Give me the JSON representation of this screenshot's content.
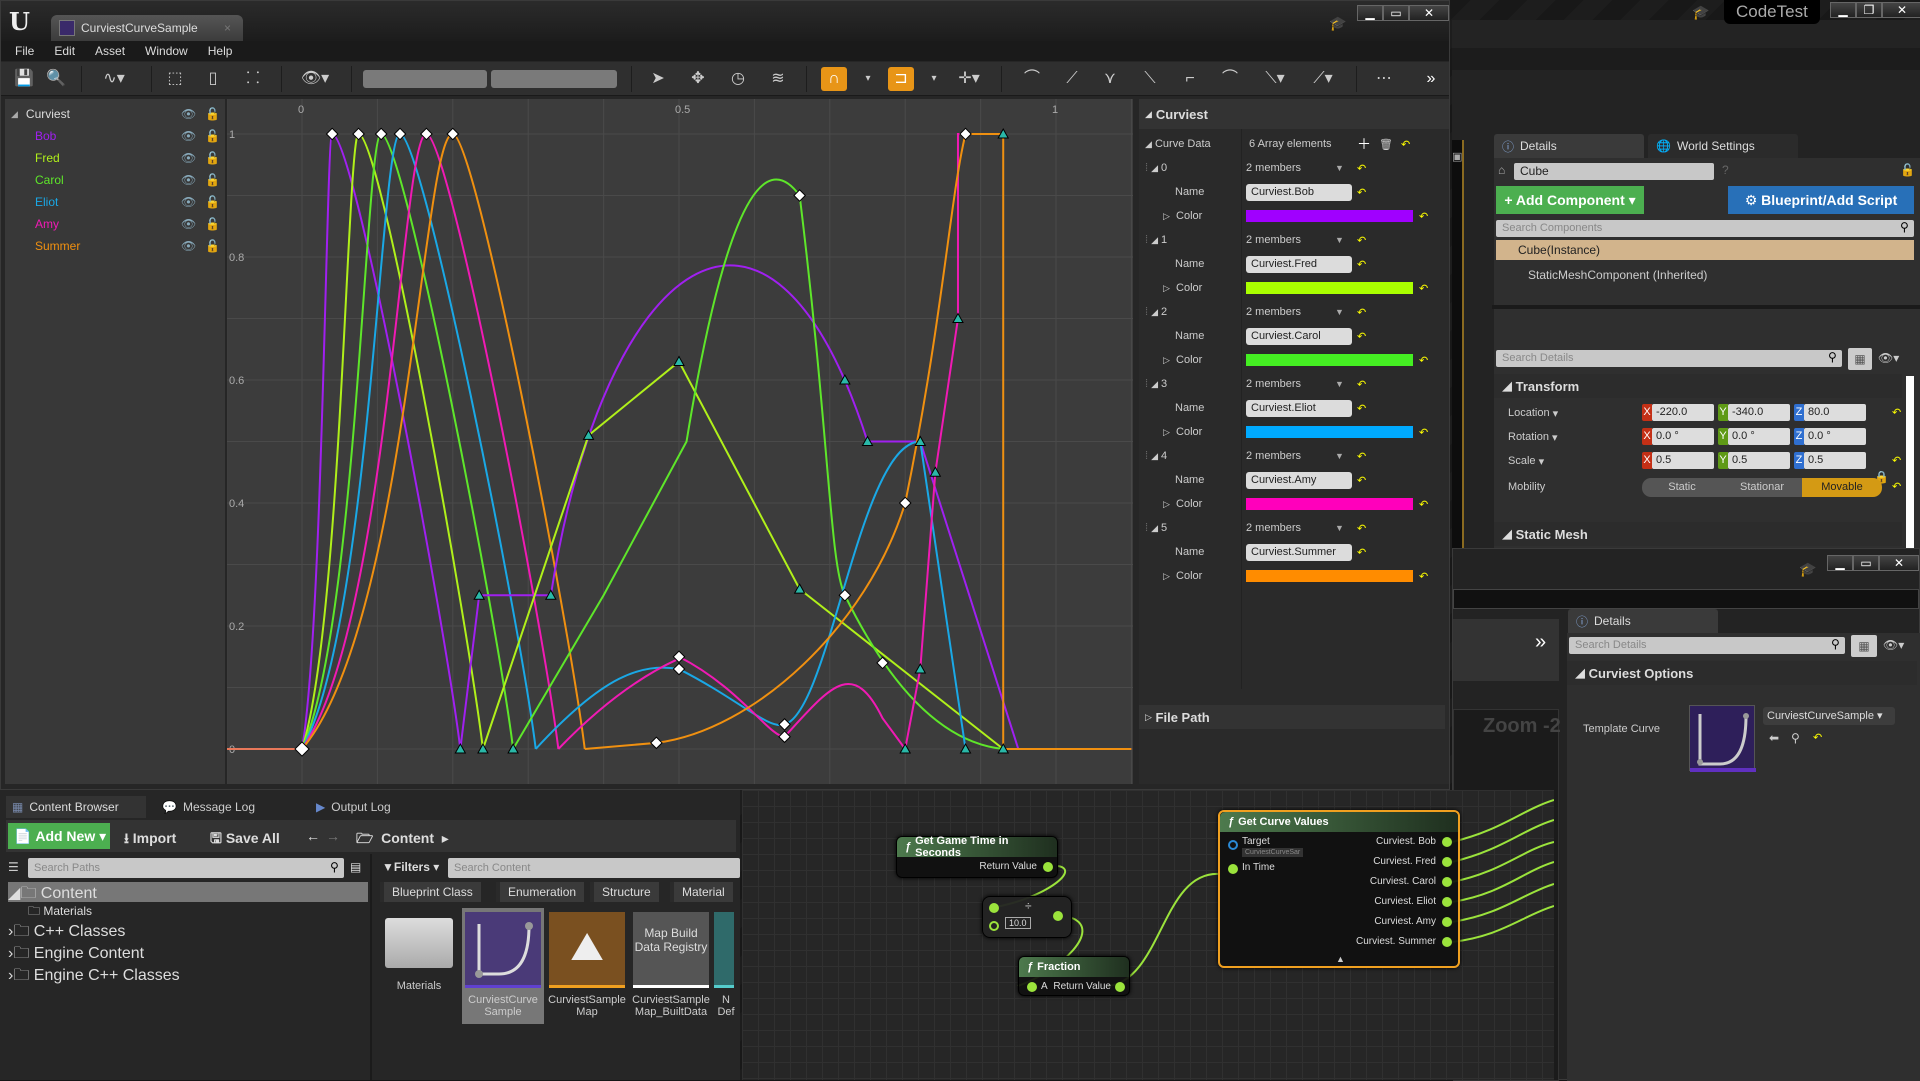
{
  "app": {
    "engine_logo": "U",
    "document_tab": "CurviestCurveSample",
    "project_title": "CodeTest"
  },
  "menu": [
    "File",
    "Edit",
    "Asset",
    "Window",
    "Help"
  ],
  "window_buttons": {
    "minimize": "▁",
    "maximize": "▭",
    "close": "✕"
  },
  "tree": {
    "root": "Curviest",
    "curves": [
      {
        "name": "Bob",
        "color": "#a020f0"
      },
      {
        "name": "Fred",
        "color": "#b0f01a"
      },
      {
        "name": "Carol",
        "color": "#5ee62a"
      },
      {
        "name": "Eliot",
        "color": "#1aa8e6"
      },
      {
        "name": "Amy",
        "color": "#f01ab4"
      },
      {
        "name": "Summer",
        "color": "#f09010"
      }
    ]
  },
  "graph": {
    "x_ticks": [
      "0",
      "0.5",
      "1"
    ],
    "y_ticks": [
      "1",
      "0.8",
      "0.6",
      "0.4",
      "0.2",
      "0"
    ]
  },
  "curviest_panel": {
    "header": "Curviest",
    "curve_data_label": "Curve Data",
    "array_count": "6 Array elements",
    "members_label": "2 members",
    "name_label": "Name",
    "color_label": "Color",
    "elements": [
      {
        "index": "0",
        "name": "Curviest.Bob",
        "color": "#a000ff"
      },
      {
        "index": "1",
        "name": "Curviest.Fred",
        "color": "#aaff00"
      },
      {
        "index": "2",
        "name": "Curviest.Carol",
        "color": "#44ee22"
      },
      {
        "index": "3",
        "name": "Curviest.Eliot",
        "color": "#00aaff"
      },
      {
        "index": "4",
        "name": "Curviest.Amy",
        "color": "#ff00bb"
      },
      {
        "index": "5",
        "name": "Curviest.Summer",
        "color": "#ff8c00"
      }
    ],
    "file_path": "File Path"
  },
  "level_details": {
    "tabs": [
      "Details",
      "World Settings"
    ],
    "actor_name": "Cube",
    "add_component": "+ Add Component",
    "blueprint_button": "Blueprint/Add Script",
    "search_components": "Search Components",
    "components": [
      "Cube(Instance)",
      "StaticMeshComponent (Inherited)"
    ],
    "search_details": "Search Details",
    "transform_header": "Transform",
    "location": {
      "label": "Location",
      "x": "-220.0",
      "y": "-340.0",
      "z": "80.0"
    },
    "rotation": {
      "label": "Rotation",
      "x": "0.0 °",
      "y": "0.0 °",
      "z": "0.0 °"
    },
    "scale": {
      "label": "Scale",
      "x": "0.5",
      "y": "0.5",
      "z": "0.5"
    },
    "mobility": {
      "label": "Mobility",
      "options": [
        "Static",
        "Stationar",
        "Movable"
      ],
      "selected": "Movable"
    },
    "static_mesh_header": "Static Mesh"
  },
  "content_browser": {
    "tabs": [
      "Content Browser",
      "Message Log",
      "Output Log"
    ],
    "add_new": "Add New",
    "import": "Import",
    "save_all": "Save All",
    "path": "Content",
    "search_paths": "Search Paths",
    "filters": "Filters",
    "search_content": "Search Content",
    "filter_chips": [
      "Blueprint Class",
      "Enumeration",
      "Structure",
      "Material"
    ],
    "folders": [
      "Content",
      "Materials",
      "C++ Classes",
      "Engine Content",
      "Engine C++ Classes"
    ],
    "assets": [
      {
        "label": "Materials"
      },
      {
        "label": "CurviestCurve Sample"
      },
      {
        "label": "CurviestSample Map"
      },
      {
        "label": "CurviestSample Map_BuiltData",
        "thumb_text": "Map Build Data Registry"
      },
      {
        "label": "N Def"
      }
    ]
  },
  "blueprint": {
    "zoom": "Zoom -2",
    "nodes": {
      "game_time": {
        "title": "Get Game Time in Seconds",
        "out": "Return Value"
      },
      "divide": {
        "symbol": "÷",
        "b_value": "10.0"
      },
      "fraction": {
        "title": "Fraction",
        "in": "A",
        "out": "Return Value"
      },
      "curve_values": {
        "title": "Get Curve Values",
        "target": "Target",
        "target_value": "CurviestCurveSar",
        "in_time": "In Time",
        "outputs": [
          "Curviest. Bob",
          "Curviest. Fred",
          "Curviest. Carol",
          "Curviest. Eliot",
          "Curviest. Amy",
          "Curviest. Summer"
        ]
      }
    }
  },
  "lower_details": {
    "tab": "Details",
    "search": "Search Details",
    "section": "Curviest Options",
    "template_label": "Template Curve",
    "template_value": "CurviestCurveSample"
  }
}
